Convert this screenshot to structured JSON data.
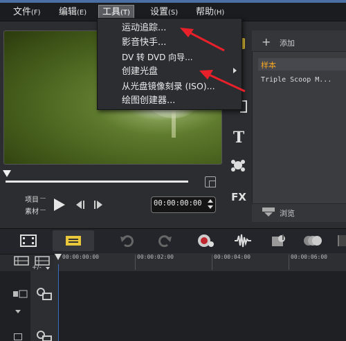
{
  "menubar": {
    "items": [
      {
        "label": "文件",
        "accel": "(F)"
      },
      {
        "label": "编辑",
        "accel": "(E)"
      },
      {
        "label": "工具",
        "accel": "(T)"
      },
      {
        "label": "设置",
        "accel": "(S)"
      },
      {
        "label": "帮助",
        "accel": "(H)"
      }
    ]
  },
  "tools_menu": {
    "items": [
      {
        "label": "运动追踪..."
      },
      {
        "label": "影音快手..."
      },
      {
        "label": "DV 转 DVD 向导..."
      },
      {
        "label": "创建光盘"
      },
      {
        "label": "从光盘镜像刻录 (ISO)..."
      },
      {
        "label": "绘图创建器..."
      }
    ]
  },
  "player": {
    "project_label": "项目",
    "clip_label": "素材",
    "timecode": "00:00:00:00",
    "progress": 0
  },
  "library": {
    "add_label": "添加",
    "items": [
      "样本",
      "Triple Scoop M..."
    ],
    "browse_label": "浏览"
  },
  "side_toolbar": {
    "title_icon_text": "T",
    "fx_text": "FX"
  },
  "timeline": {
    "ruler_ticks": [
      "00:00:00:00",
      "00:00:02:00",
      "00:00:04:00",
      "00:00:06:00"
    ],
    "zoom_label": "+/-"
  },
  "colors": {
    "menu_bg": "#1b1c1f",
    "panel_bg": "#2b2d31",
    "annotation_arrow": "#e8202a",
    "playhead": "#3a6fbf"
  }
}
